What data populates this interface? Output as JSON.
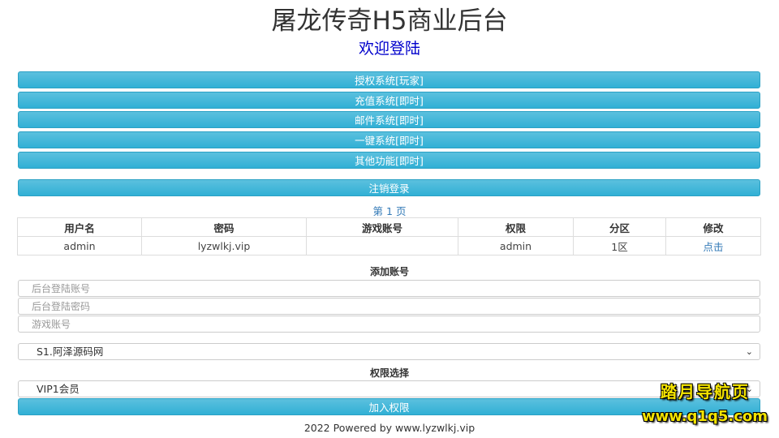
{
  "header": {
    "title": "屠龙传奇H5商业后台",
    "subtitle": "欢迎登陆"
  },
  "menu": {
    "items": [
      {
        "label": "授权系统[玩家]"
      },
      {
        "label": "充值系统[即时]"
      },
      {
        "label": "邮件系统[即时]"
      },
      {
        "label": "一键系统[即时]"
      },
      {
        "label": "其他功能[即时]"
      }
    ],
    "logout_label": "注销登录"
  },
  "accounts": {
    "page_label": "第 1 页",
    "columns": [
      "用户名",
      "密码",
      "游戏账号",
      "权限",
      "分区",
      "修改"
    ],
    "rows": [
      {
        "username": "admin",
        "password": "lyzwlkj.vip",
        "game_account": "",
        "permission": "admin",
        "zone": "1区",
        "edit": "点击"
      }
    ]
  },
  "add_account": {
    "section_label": "添加账号",
    "login_placeholder": "后台登陆账号",
    "password_placeholder": "后台登陆密码",
    "game_placeholder": "游戏账号",
    "server_selected": "S1.阿泽源码网",
    "permission_section_label": "权限选择",
    "permission_selected": "VIP1会员",
    "submit_label": "加入权限"
  },
  "footer": {
    "text": "2022 Powered by www.lyzwlkj.vip"
  },
  "watermark": {
    "line1": "踏月导航页",
    "line2": "www.q1q5.com"
  },
  "colors": {
    "button": "#5bc0de",
    "link": "#337ab7",
    "subtitle": "#0000cc",
    "watermark": "#f5e400"
  }
}
